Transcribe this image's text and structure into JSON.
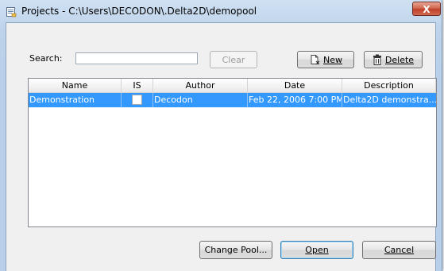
{
  "window": {
    "title": "Projects - C:\\Users\\DECODON\\.Delta2D\\demopool",
    "close_label": "X"
  },
  "search": {
    "label": "Search:",
    "value": "",
    "placeholder": "",
    "clear_label": "Clear"
  },
  "toolbar": {
    "new_label": "New",
    "delete_label": "Delete"
  },
  "table": {
    "columns": [
      "Name",
      "IS",
      "Author",
      "Date",
      "Description"
    ],
    "rows": [
      {
        "name": "Demonstration",
        "is_checked": false,
        "author": "Decodon",
        "date": "Feb 22, 2006 7:00 PM",
        "description": "Delta2D demonstra..."
      }
    ]
  },
  "footer": {
    "change_pool_label": "Change Pool...",
    "open_label": "Open",
    "cancel_label": "Cancel"
  },
  "colors": {
    "selection": "#3399ff",
    "close_button": "#c0402a"
  },
  "icons": {
    "app": "projects-window-icon",
    "new": "new-document-icon",
    "delete": "trash-icon"
  }
}
